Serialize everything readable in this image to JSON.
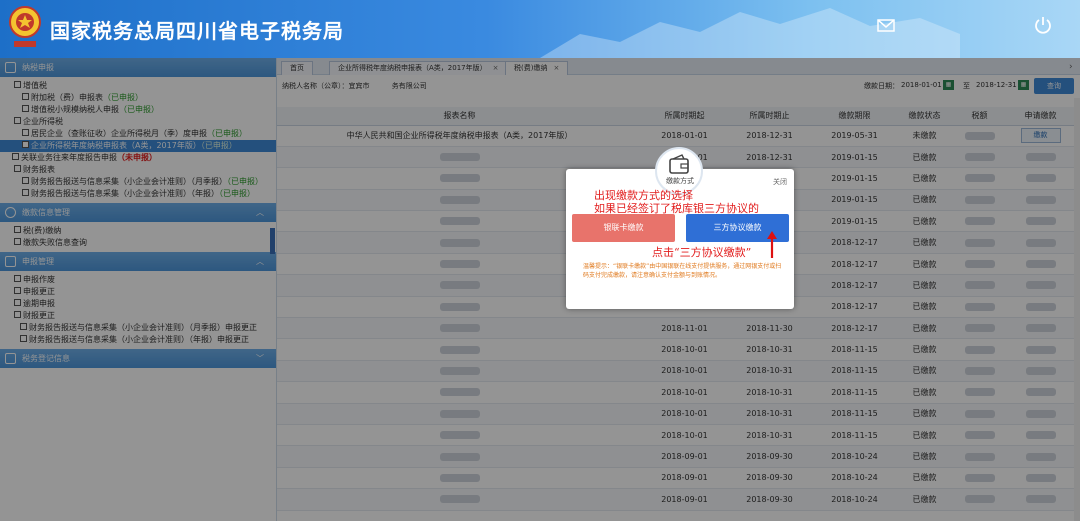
{
  "header": {
    "title": "国家税务总局四川省电子税务局",
    "icons": [
      "mail-icon",
      "power-icon"
    ]
  },
  "sidebar": {
    "sections": [
      {
        "title": "纳税申报"
      },
      {
        "title": "缴款信息管理"
      },
      {
        "title": "申报管理"
      },
      {
        "title": "税务登记信息"
      }
    ],
    "declare_tree": [
      {
        "label": "增值税",
        "status": "",
        "level": "lvl0"
      },
      {
        "label": "附加税（费）申报表",
        "status": "（已申报）",
        "level": "lvl1"
      },
      {
        "label": "增值税小规模纳税人申报",
        "status": "（已申报）",
        "level": "lvl1"
      },
      {
        "label": "企业所得税",
        "status": "",
        "level": "lvl0"
      },
      {
        "label": "居民企业（查账征收）企业所得税月（季）度申报",
        "status": "（已申报）",
        "level": "lvl1"
      },
      {
        "label": "企业所得税年度纳税申报表（A类，2017年版）",
        "status": "（已申报）",
        "level": "lvl1",
        "selected": true
      },
      {
        "label": "关联业务往来年度报告申报",
        "status": "（未申报）",
        "level": "lvl1b",
        "red": true
      },
      {
        "label": "财务报表",
        "status": "",
        "level": "lvl0"
      },
      {
        "label": "财务报告报送与信息采集（小企业会计准则）（月季报）",
        "status": "（已申报）",
        "level": "lvl1"
      },
      {
        "label": "财务报告报送与信息采集（小企业会计准则）（年报）",
        "status": "（已申报）",
        "level": "lvl1"
      }
    ],
    "payment_tree": [
      {
        "label": "税(费)缴纳"
      },
      {
        "label": "缴款失败信息查询"
      }
    ],
    "manage_tree": [
      {
        "label": "申报作废",
        "level": "lvl0"
      },
      {
        "label": "申报更正",
        "level": "lvl0"
      },
      {
        "label": "逾期申报",
        "level": "lvl0"
      },
      {
        "label": "财报更正",
        "level": "lvl0"
      },
      {
        "label": "财务报告报送与信息采集（小企业会计准则）（月季报）申报更正",
        "level": "lvl2"
      },
      {
        "label": "财务报告报送与信息采集（小企业会计准则）（年报）申报更正",
        "level": "lvl2"
      }
    ]
  },
  "tabs": [
    {
      "label": "首页"
    },
    {
      "label": "企业所得税年度纳税申报表（A类，2017年版）"
    },
    {
      "label": "税(费)缴纳"
    }
  ],
  "filter": {
    "taxpayer_label": "纳税人名称（公章）：",
    "taxpayer_partial_1": "宜宾市",
    "taxpayer_partial_2": "务有限公司",
    "date_label": "缴款日期：",
    "date_from": "2018-01-01",
    "to": "至",
    "date_to": "2018-12-31",
    "query_button": "查询"
  },
  "table": {
    "columns": [
      "报表名称",
      "所属时期起",
      "所属时期止",
      "缴款期限",
      "缴款状态",
      "税额",
      "申请缴款"
    ],
    "rows": [
      {
        "name": "中华人民共和国企业所得税年度纳税申报表（A类，2017年版）",
        "start": "2018-01-01",
        "end": "2018-12-31",
        "deadline": "2019-05-31",
        "status": "未缴款",
        "action": "缴款"
      },
      {
        "name": "",
        "start": "2018-12-01",
        "end": "2018-12-31",
        "deadline": "2019-01-15",
        "status": "已缴款",
        "action": ""
      },
      {
        "name": "",
        "start": "2018-12-01",
        "end": "2018-12-31",
        "deadline": "2019-01-15",
        "status": "已缴款",
        "action": ""
      },
      {
        "name": "",
        "start": "2018-12-01",
        "end": "2018-12-31",
        "deadline": "2019-01-15",
        "status": "已缴款",
        "action": ""
      },
      {
        "name": "",
        "start": "2018-12-01",
        "end": "2018-12-31",
        "deadline": "2019-01-15",
        "status": "已缴款",
        "action": ""
      },
      {
        "name": "",
        "start": "2018-11-01",
        "end": "2018-11-30",
        "deadline": "2018-12-17",
        "status": "已缴款",
        "action": ""
      },
      {
        "name": "",
        "start": "2018-11-01",
        "end": "2018-11-30",
        "deadline": "2018-12-17",
        "status": "已缴款",
        "action": ""
      },
      {
        "name": "",
        "start": "2018-11-01",
        "end": "2018-11-30",
        "deadline": "2018-12-17",
        "status": "已缴款",
        "action": ""
      },
      {
        "name": "",
        "start": "2018-11-01",
        "end": "2018-11-30",
        "deadline": "2018-12-17",
        "status": "已缴款",
        "action": ""
      },
      {
        "name": "",
        "start": "2018-11-01",
        "end": "2018-11-30",
        "deadline": "2018-12-17",
        "status": "已缴款",
        "action": ""
      },
      {
        "name": "",
        "start": "2018-10-01",
        "end": "2018-10-31",
        "deadline": "2018-11-15",
        "status": "已缴款",
        "action": ""
      },
      {
        "name": "",
        "start": "2018-10-01",
        "end": "2018-10-31",
        "deadline": "2018-11-15",
        "status": "已缴款",
        "action": ""
      },
      {
        "name": "",
        "start": "2018-10-01",
        "end": "2018-10-31",
        "deadline": "2018-11-15",
        "status": "已缴款",
        "action": ""
      },
      {
        "name": "",
        "start": "2018-10-01",
        "end": "2018-10-31",
        "deadline": "2018-11-15",
        "status": "已缴款",
        "action": ""
      },
      {
        "name": "",
        "start": "2018-10-01",
        "end": "2018-10-31",
        "deadline": "2018-11-15",
        "status": "已缴款",
        "action": ""
      },
      {
        "name": "",
        "start": "2018-09-01",
        "end": "2018-09-30",
        "deadline": "2018-10-24",
        "status": "已缴款",
        "action": ""
      },
      {
        "name": "",
        "start": "2018-09-01",
        "end": "2018-09-30",
        "deadline": "2018-10-24",
        "status": "已缴款",
        "action": ""
      },
      {
        "name": "",
        "start": "2018-09-01",
        "end": "2018-09-30",
        "deadline": "2018-10-24",
        "status": "已缴款",
        "action": ""
      }
    ]
  },
  "modal": {
    "title": "缴款方式",
    "close": "关闭",
    "annotation_1": "出现缴款方式的选择",
    "annotation_2": "如果已经签订了税库银三方协议的",
    "btn_card": "银联卡缴款",
    "btn_tripartite": "三方协议缴款",
    "annotation_3": "点击“三方协议缴款”",
    "note": "温馨提示：“银联卡缴款”由中国银联在线支付提供服务，通过网银支付或扫码支付完成缴款，请注意确认支付金额与到账情况。",
    "colors": {
      "card_button": "#e8736b",
      "tripartite_button": "#2f6fd6",
      "annotation": "#e21c1c"
    }
  }
}
